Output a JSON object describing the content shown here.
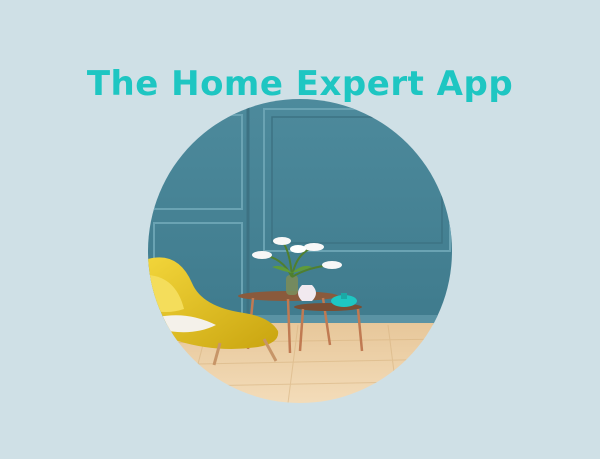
{
  "header": {
    "title": "The Home Expert App"
  },
  "hero_image": {
    "subject": "living room interior photo",
    "colors": {
      "wall": "#4d8a9c",
      "chair": "#e3c326",
      "floor": "#e9c99c",
      "accent": "#1ec6c2"
    }
  }
}
